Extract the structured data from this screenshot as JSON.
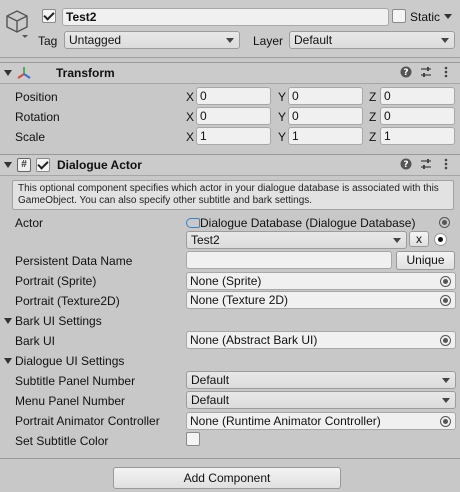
{
  "gameobject": {
    "name": "Test2",
    "active": true,
    "static_label": "Static",
    "tag_label": "Tag",
    "tag_value": "Untagged",
    "layer_label": "Layer",
    "layer_value": "Default"
  },
  "transform": {
    "title": "Transform",
    "rows": [
      {
        "label": "Position",
        "x": "0",
        "y": "0",
        "z": "0"
      },
      {
        "label": "Rotation",
        "x": "0",
        "y": "0",
        "z": "0"
      },
      {
        "label": "Scale",
        "x": "1",
        "y": "1",
        "z": "1"
      }
    ],
    "axis_x": "X",
    "axis_y": "Y",
    "axis_z": "Z"
  },
  "dialogue_actor": {
    "title": "Dialogue Actor",
    "enabled": true,
    "help_text": "This optional component specifies which actor in your dialogue database is associated with this GameObject. You can also specify other subtitle and bark settings.",
    "actor_label": "Actor",
    "actor_database": "Dialogue Database (Dialogue Database)",
    "actor_value": "Test2",
    "clear_button": "x",
    "persistent_label": "Persistent Data Name",
    "persistent_value": "",
    "unique_button": "Unique",
    "portrait_sprite_label": "Portrait (Sprite)",
    "portrait_sprite_value": "None (Sprite)",
    "portrait_tex_label": "Portrait (Texture2D)",
    "portrait_tex_value": "None (Texture 2D)",
    "bark_section": "Bark UI Settings",
    "bark_ui_label": "Bark UI",
    "bark_ui_value": "None (Abstract Bark UI)",
    "dialogue_section": "Dialogue UI Settings",
    "subtitle_panel_label": "Subtitle Panel Number",
    "subtitle_panel_value": "Default",
    "menu_panel_label": "Menu Panel Number",
    "menu_panel_value": "Default",
    "animator_label": "Portrait Animator Controller",
    "animator_value": "None (Runtime Animator Controller)",
    "subtitle_color_label": "Set Subtitle Color",
    "subtitle_color_checked": false
  },
  "add_component_button": "Add Component",
  "colors": {
    "background": "#c8c8c8",
    "field": "#f0f0f0",
    "transform_icon_red": "#d84a3a",
    "transform_icon_green": "#4caf50",
    "transform_icon_blue": "#3a6fd8"
  }
}
